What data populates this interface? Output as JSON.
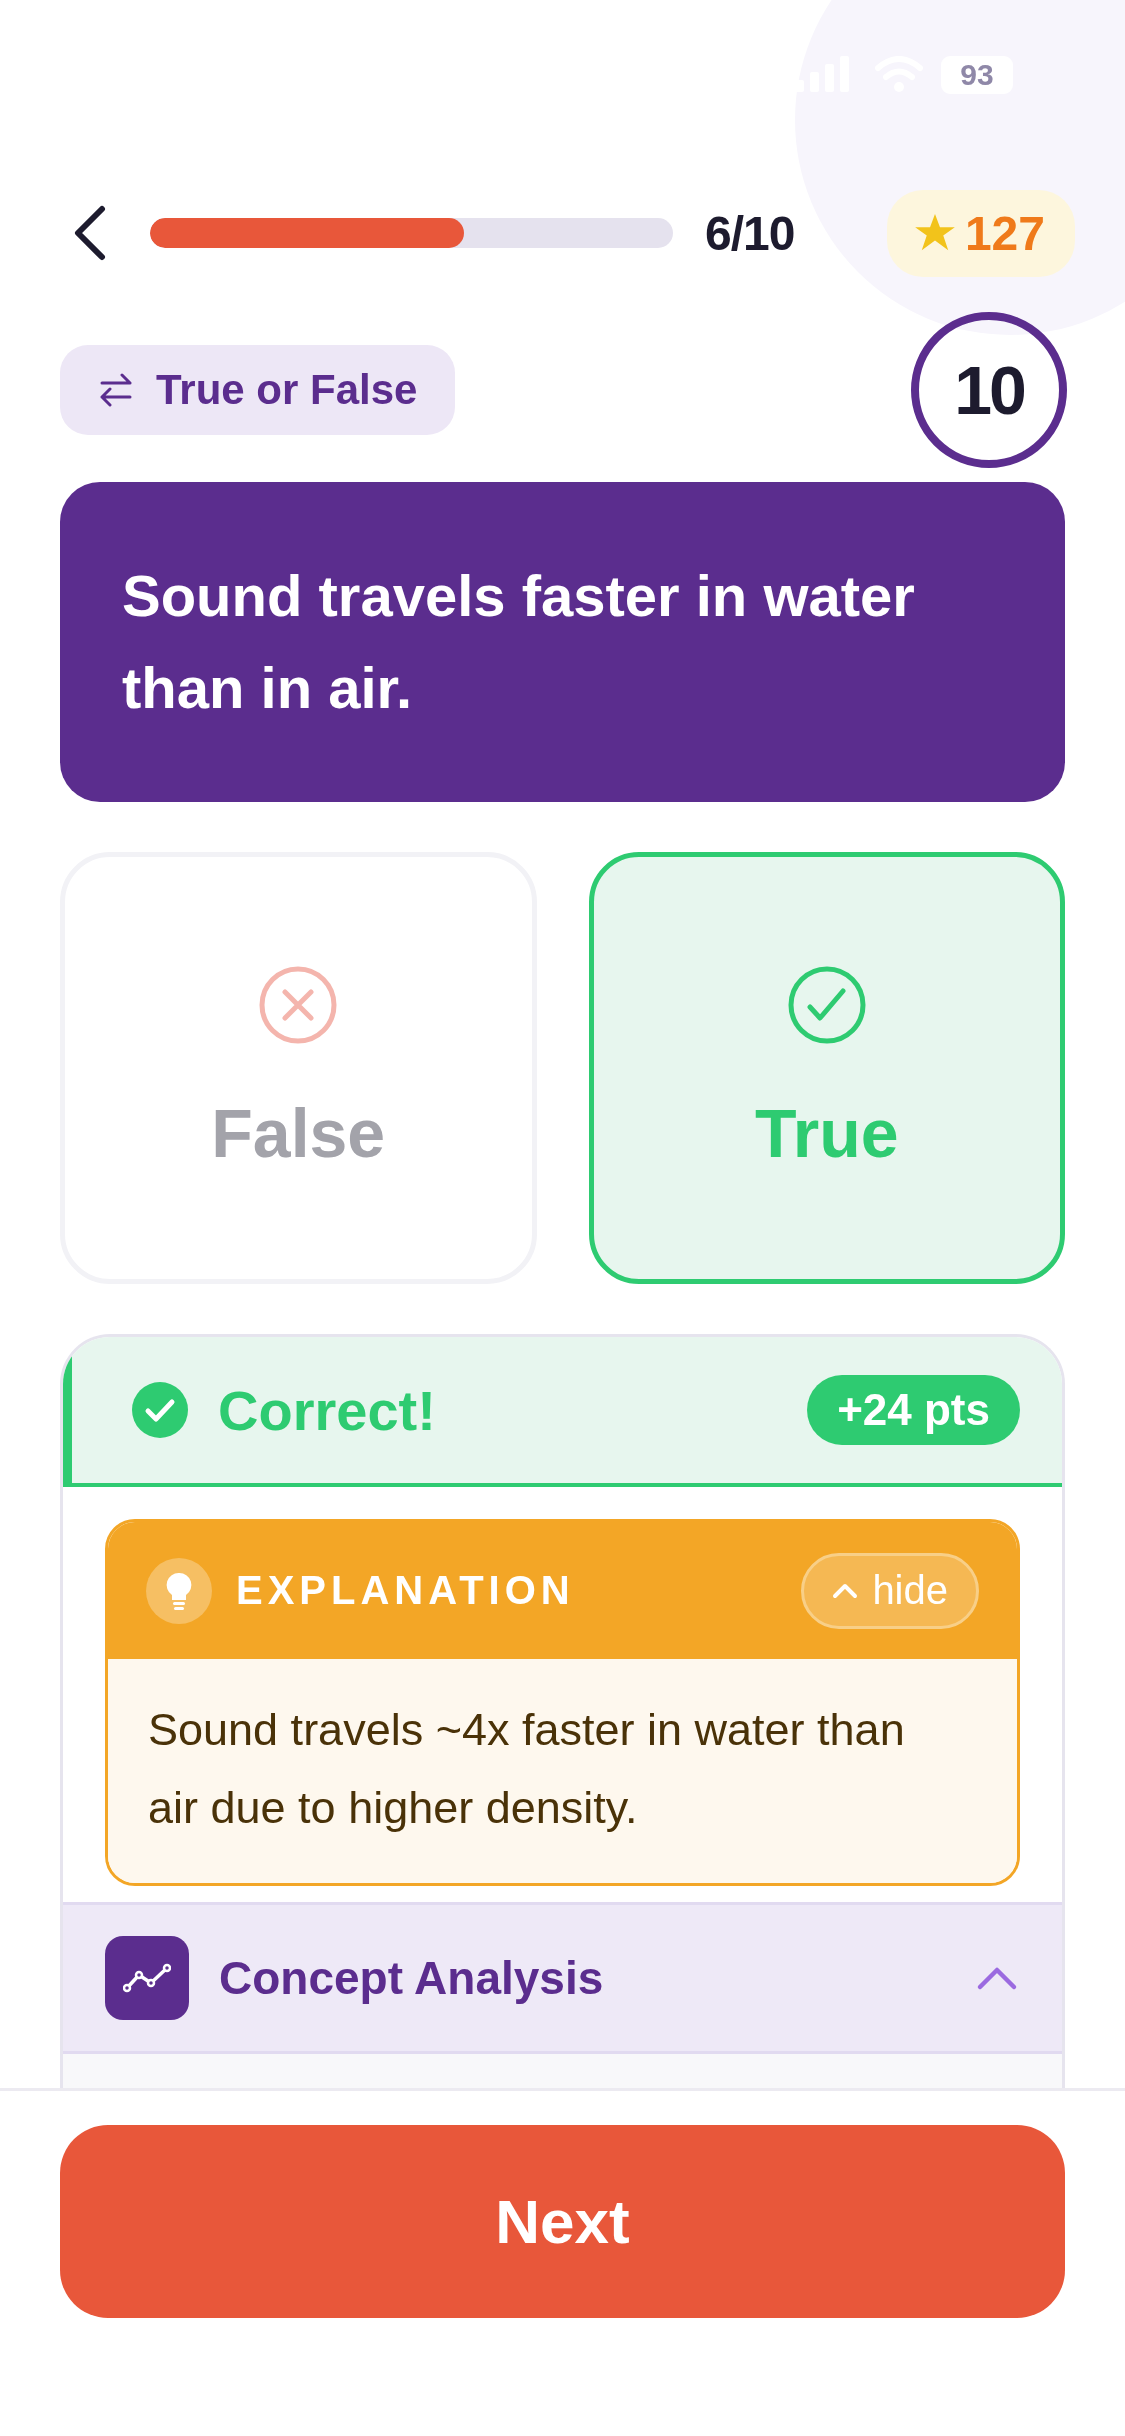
{
  "status_bar": {
    "battery": "93"
  },
  "header": {
    "progress": {
      "level": 0.6
    },
    "counter": "6/10",
    "score": "127"
  },
  "tag": {
    "label": "True or False"
  },
  "timer": "10",
  "question": "Sound travels faster in water than in air.",
  "options": [
    {
      "kind": "false",
      "label": "False",
      "selected": false
    },
    {
      "kind": "true",
      "label": "True",
      "selected": true
    }
  ],
  "result": {
    "correct": true,
    "status": "Correct!",
    "points": "+24 pts",
    "explanation": {
      "title": "EXPLANATION",
      "toggle": "hide",
      "expanded": true,
      "text": "Sound travels ~4x faster in water than air due to higher density."
    },
    "sections": [
      {
        "title": "Concept Analysis",
        "expanded": true
      }
    ]
  },
  "next_button": "Next"
}
